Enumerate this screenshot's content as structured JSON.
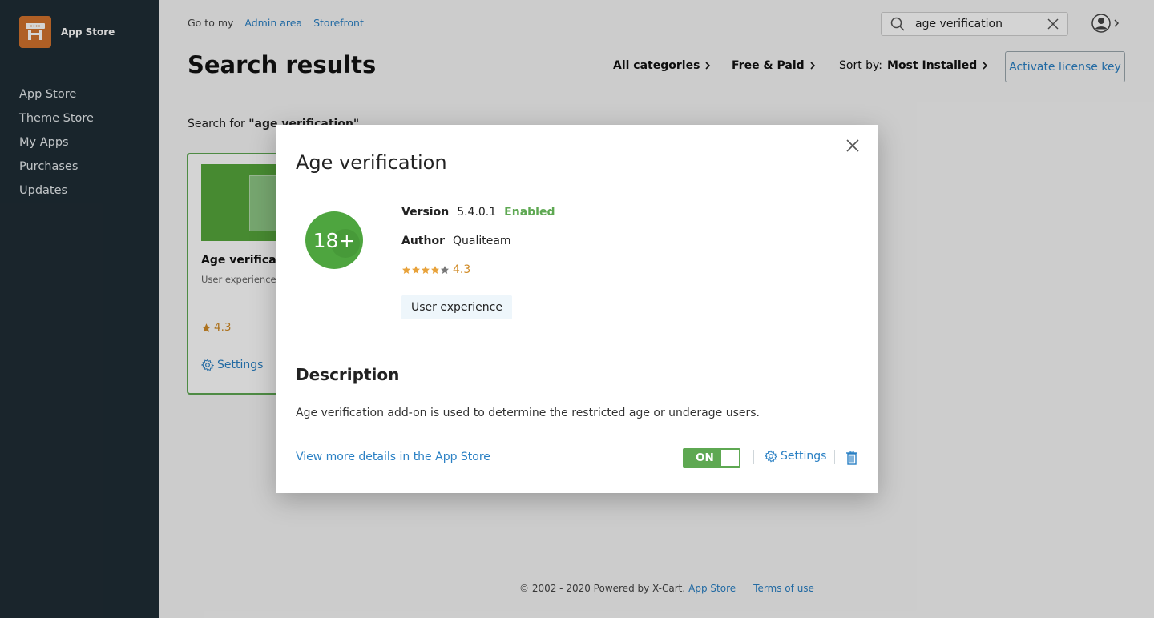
{
  "sidebar": {
    "brand": "App Store",
    "items": [
      {
        "label": "App Store"
      },
      {
        "label": "Theme Store"
      },
      {
        "label": "My Apps"
      },
      {
        "label": "Purchases"
      },
      {
        "label": "Updates"
      }
    ]
  },
  "header": {
    "goto_prefix": "Go to my",
    "goto_links": [
      "Admin area",
      "Storefront"
    ],
    "search_value": "age verification"
  },
  "page": {
    "title": "Search results",
    "filters": {
      "categories": "All categories",
      "price": "Free & Paid",
      "sort_prefix": "Sort by:",
      "sort_value": "Most Installed"
    },
    "license_button": "Activate license key",
    "search_for_prefix": "Search for",
    "search_for_query": "\"age verification\""
  },
  "card": {
    "title": "Age verification",
    "category": "User experience",
    "rating": "4.3",
    "settings": "Settings"
  },
  "footer": {
    "copyright": "© 2002 - 2020 Powered by X-Cart.",
    "app_store_link": "App Store",
    "terms_link": "Terms of use"
  },
  "modal": {
    "title": "Age verification",
    "badge_text": "18+",
    "version_label": "Version",
    "version_value": "5.4.0.1",
    "status": "Enabled",
    "author_label": "Author",
    "author_value": "Qualiteam",
    "rating": "4.3",
    "rating_value": 4.3,
    "rating_max": 5,
    "tag": "User experience",
    "description_heading": "Description",
    "description": "Age verification add-on is used to determine the restricted age or underage users.",
    "more_link": "View more details in the App Store",
    "toggle_label": "ON",
    "settings": "Settings"
  },
  "colors": {
    "sidebar_bg": "#1f2d35",
    "logo": "#d3732d",
    "link": "#2a80c4",
    "green": "#5ea852",
    "rating": "#d08a25"
  }
}
